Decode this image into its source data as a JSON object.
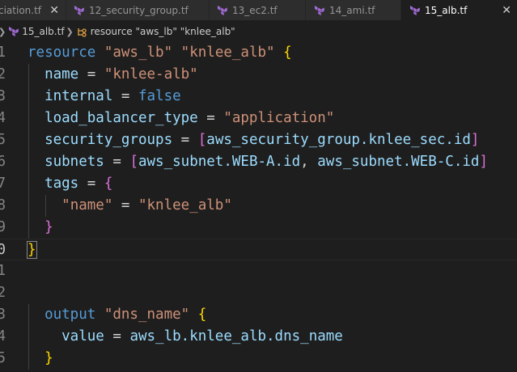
{
  "tabs": [
    {
      "label": "ciation.tf",
      "active": false,
      "has_icon": false
    },
    {
      "label": "12_security_group.tf",
      "active": false,
      "has_icon": true
    },
    {
      "label": "13_ec2.tf",
      "active": false,
      "has_icon": true
    },
    {
      "label": "14_ami.tf",
      "active": false,
      "has_icon": true
    },
    {
      "label": "15_alb.tf",
      "active": true,
      "has_icon": true
    }
  ],
  "close_glyph": "✕",
  "breadcrumb": {
    "file": "15_alb.tf",
    "symbol": "resource \"aws_lb\" \"knlee_alb\""
  },
  "editor": {
    "line_numbers": [
      "1",
      "2",
      "3",
      "4",
      "5",
      "6",
      "7",
      "8",
      "9",
      "0",
      "1",
      "2",
      "3",
      "4",
      "5"
    ],
    "current_line_index": 9,
    "lines": [
      {
        "tokens": [
          {
            "t": "resource ",
            "c": "kw"
          },
          {
            "t": "\"aws_lb\"",
            "c": "str"
          },
          {
            "t": " ",
            "c": ""
          },
          {
            "t": "\"knlee_alb\"",
            "c": "str"
          },
          {
            "t": " ",
            "c": ""
          },
          {
            "t": "{",
            "c": "br1"
          }
        ]
      },
      {
        "tokens": [
          {
            "t": "  name",
            "c": "attr"
          },
          {
            "t": " = ",
            "c": ""
          },
          {
            "t": "\"knlee-alb\"",
            "c": "str"
          }
        ]
      },
      {
        "tokens": [
          {
            "t": "  internal",
            "c": "attr"
          },
          {
            "t": " = ",
            "c": ""
          },
          {
            "t": "false",
            "c": "kw"
          }
        ]
      },
      {
        "tokens": [
          {
            "t": "  load_balancer_type",
            "c": "attr"
          },
          {
            "t": " = ",
            "c": ""
          },
          {
            "t": "\"application\"",
            "c": "str"
          }
        ]
      },
      {
        "tokens": [
          {
            "t": "  security_groups",
            "c": "attr"
          },
          {
            "t": " = ",
            "c": ""
          },
          {
            "t": "[",
            "c": "br2"
          },
          {
            "t": "aws_security_group.knlee_sec.id",
            "c": "attr"
          },
          {
            "t": "]",
            "c": "br2"
          }
        ]
      },
      {
        "tokens": [
          {
            "t": "  subnets",
            "c": "attr"
          },
          {
            "t": " = ",
            "c": ""
          },
          {
            "t": "[",
            "c": "br2"
          },
          {
            "t": "aws_subnet.WEB-A.id",
            "c": "attr"
          },
          {
            "t": ", ",
            "c": ""
          },
          {
            "t": "aws_subnet.WEB-C.id",
            "c": "attr"
          },
          {
            "t": "]",
            "c": "br2"
          }
        ]
      },
      {
        "tokens": [
          {
            "t": "  tags",
            "c": "attr"
          },
          {
            "t": " = ",
            "c": ""
          },
          {
            "t": "{",
            "c": "br2"
          }
        ]
      },
      {
        "tokens": [
          {
            "t": "    ",
            "c": ""
          },
          {
            "t": "\"name\"",
            "c": "str"
          },
          {
            "t": " = ",
            "c": ""
          },
          {
            "t": "\"knlee_alb\"",
            "c": "str"
          }
        ]
      },
      {
        "tokens": [
          {
            "t": "  ",
            "c": ""
          },
          {
            "t": "}",
            "c": "br2"
          }
        ]
      },
      {
        "tokens": [
          {
            "t": "}",
            "c": "br1 br-match"
          }
        ]
      },
      {
        "tokens": []
      },
      {
        "tokens": []
      },
      {
        "tokens": [
          {
            "t": "  output ",
            "c": "kw"
          },
          {
            "t": "\"dns_name\"",
            "c": "str"
          },
          {
            "t": " ",
            "c": ""
          },
          {
            "t": "{",
            "c": "br1"
          }
        ]
      },
      {
        "tokens": [
          {
            "t": "    value",
            "c": "attr"
          },
          {
            "t": " = ",
            "c": ""
          },
          {
            "t": "aws_lb.knlee_alb.dns_name",
            "c": "attr"
          }
        ]
      },
      {
        "tokens": [
          {
            "t": "  ",
            "c": ""
          },
          {
            "t": "}",
            "c": "br1"
          }
        ]
      }
    ]
  }
}
